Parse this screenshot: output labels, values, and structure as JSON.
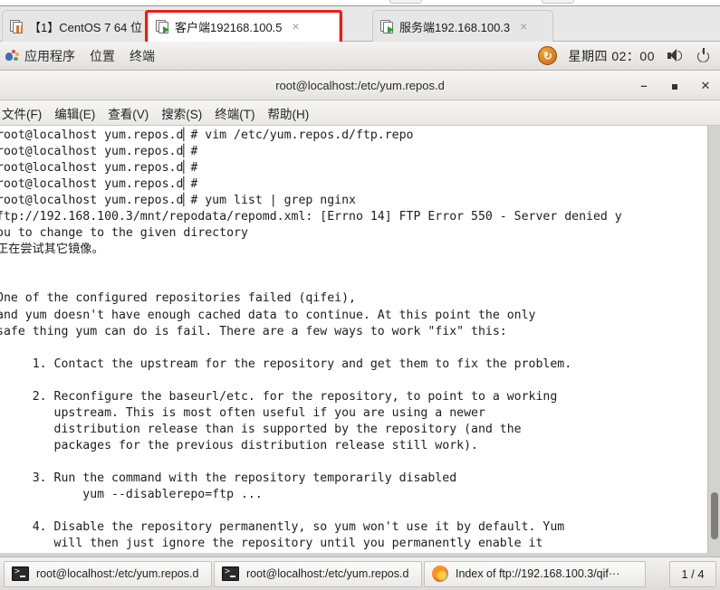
{
  "vm_tabs": {
    "highlighted_index": 1,
    "items": [
      {
        "label": "【1】CentOS 7 64 位",
        "state_icon": "pause-badge-icon",
        "active": false,
        "close_label": "×"
      },
      {
        "label": "客户端192168.100.5",
        "state_icon": "play-badge-icon",
        "active": true,
        "close_label": "×"
      },
      {
        "label": "服务端192.168.100.3",
        "state_icon": "play-badge-icon",
        "active": false,
        "close_label": "×"
      }
    ]
  },
  "panel": {
    "menus": [
      "应用程序",
      "位置",
      "终端"
    ],
    "clock": "星期四 02：00",
    "badge_glyph": "↻",
    "volume_icon": "speaker-icon",
    "power_icon": "power-icon"
  },
  "terminal_window": {
    "title": "root@localhost:/etc/yum.repos.d",
    "controls": {
      "minimize": "–",
      "maximize": "■",
      "close": "✕"
    },
    "menus": [
      "文件(F)",
      "编辑(E)",
      "查看(V)",
      "搜索(S)",
      "终端(T)",
      "帮助(H)"
    ],
    "content": "root@localhost yum.repos.d▏# vim /etc/yum.repos.d/ftp.repo\nroot@localhost yum.repos.d▏#\nroot@localhost yum.repos.d▏#\nroot@localhost yum.repos.d▏#\nroot@localhost yum.repos.d▏# yum list | grep nginx\nftp://192.168.100.3/mnt/repodata/repomd.xml: [Errno 14] FTP Error 550 - Server denied y\nou to change to the given directory\n正在尝试其它镜像。\n\n\nOne of the configured repositories failed (qifei),\nand yum doesn't have enough cached data to continue. At this point the only\nsafe thing yum can do is fail. There are a few ways to work \"fix\" this:\n\n     1. Contact the upstream for the repository and get them to fix the problem.\n\n     2. Reconfigure the baseurl/etc. for the repository, to point to a working\n        upstream. This is most often useful if you are using a newer\n        distribution release than is supported by the repository (and the\n        packages for the previous distribution release still work).\n\n     3. Run the command with the repository temporarily disabled\n            yum --disablerepo=ftp ...\n\n     4. Disable the repository permanently, so yum won't use it by default. Yum\n        will then just ignore the repository until you permanently enable it"
  },
  "taskbar": {
    "buttons": [
      {
        "label": "root@localhost:/etc/yum.repos.d",
        "icon": "terminal-icon"
      },
      {
        "label": "root@localhost:/etc/yum.repos.d",
        "icon": "terminal-icon"
      },
      {
        "label": "Index of ftp://192.168.100.3/qif···",
        "icon": "firefox-icon"
      }
    ],
    "pager": "1 / 4"
  },
  "colors": {
    "highlight_red": "#ee1c10",
    "panel_bg": "#eeecea",
    "terminal_bg": "#ffffff",
    "terminal_fg": "#1d1d1d"
  }
}
